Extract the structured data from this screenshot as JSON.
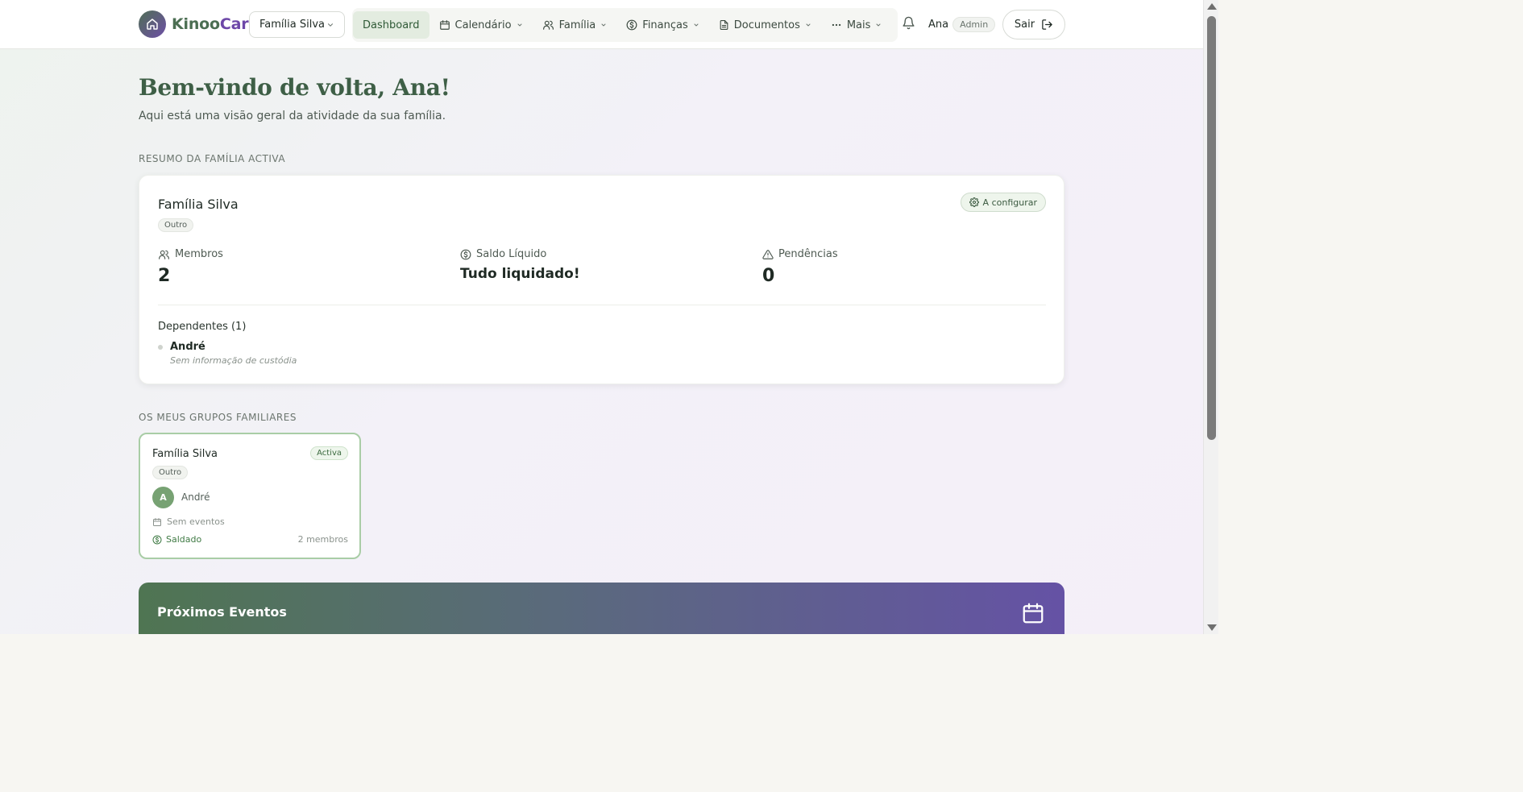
{
  "brand": {
    "name_part1": "Kinoo",
    "name_part2": "Care"
  },
  "header": {
    "family_selector": "Família Silva",
    "nav": [
      {
        "label": "Dashboard",
        "icon": "none",
        "active": true
      },
      {
        "label": "Calendário",
        "icon": "calendar-icon"
      },
      {
        "label": "Família",
        "icon": "users-icon"
      },
      {
        "label": "Finanças",
        "icon": "dollar-icon"
      },
      {
        "label": "Documentos",
        "icon": "document-icon"
      },
      {
        "label": "Mais",
        "icon": "more-icon"
      }
    ],
    "user_name": "Ana",
    "user_role": "Admin",
    "logout_label": "Sair"
  },
  "welcome": {
    "title": "Bem-vindo de volta, Ana!",
    "subtitle": "Aqui está uma visão geral da atividade da sua família."
  },
  "summary": {
    "section_label": "RESUMO DA FAMÍLIA ACTIVA",
    "family_name": "Família Silva",
    "type": "Outro",
    "config_label": "A configurar",
    "stats": {
      "members": {
        "label": "Membros",
        "value": "2"
      },
      "balance": {
        "label": "Saldo Líquido",
        "value": "Tudo liquidado!"
      },
      "pending": {
        "label": "Pendências",
        "value": "0"
      }
    },
    "dependents_title": "Dependentes (1)",
    "dependents": [
      {
        "name": "André",
        "note": "Sem informação de custódia"
      }
    ]
  },
  "groups": {
    "section_label": "OS MEUS GRUPOS FAMILIARES",
    "items": [
      {
        "name": "Família Silva",
        "status": "Activa",
        "type": "Outro",
        "avatar_initial": "A",
        "member": "André",
        "events": "Sem eventos",
        "balance": "Saldado",
        "member_count": "2 membros"
      }
    ]
  },
  "events": {
    "title": "Próximos Eventos"
  },
  "colors": {
    "brand_green": "#4b6e52",
    "brand_purple": "#6d47a8",
    "active_nav_bg": "#e3ece0"
  }
}
